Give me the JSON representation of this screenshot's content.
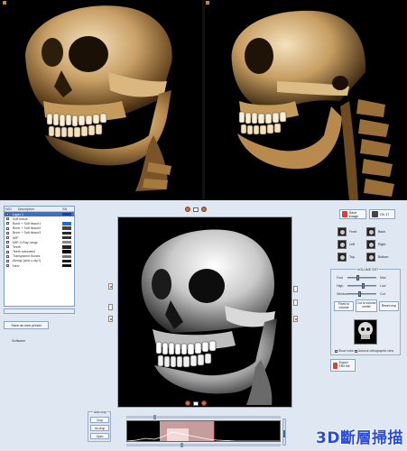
{
  "layers": {
    "headers": [
      "IVID",
      "Description",
      "SN"
    ],
    "rows": [
      {
        "label": "Layer 1",
        "selected": true,
        "color": "#1a3faa"
      },
      {
        "label": "Soft tissue",
        "selected": false,
        "color": "#ffffff"
      },
      {
        "label": "Bone + Soft tissue1",
        "selected": false,
        "color": "#1a6fd0"
      },
      {
        "label": "Bone + Soft tissue2",
        "selected": false,
        "color": "#444444"
      },
      {
        "label": "Bone + Soft tissue3",
        "selected": false,
        "color": "#2a2a2a"
      },
      {
        "label": "MIP",
        "selected": false,
        "color": "#333333"
      },
      {
        "label": "MIP-X-Ray range",
        "selected": false,
        "color": "#888888"
      },
      {
        "label": "Teeth",
        "selected": false,
        "color": "#222222"
      },
      {
        "label": "Teeth saturated",
        "selected": false,
        "color": "#000000"
      },
      {
        "label": "Transparent Bones",
        "selected": false,
        "color": "#777777"
      },
      {
        "label": "Airway (and x-ray?)",
        "selected": false,
        "color": "#1d1d1d"
      },
      {
        "label": "Nerv",
        "selected": false,
        "color": "#0f0f0f"
      }
    ]
  },
  "left_controls": {
    "button1": "",
    "button2": "Save as new preset",
    "label": "Software"
  },
  "top_tools": {
    "snapshot": "Save image",
    "export": "Oh 17"
  },
  "views": [
    {
      "label": "Front"
    },
    {
      "label": "Back"
    },
    {
      "label": "Left"
    },
    {
      "label": "Right"
    },
    {
      "label": "Top"
    },
    {
      "label": "Bottom"
    }
  ],
  "volume": {
    "title": "VOLUME SET",
    "sliders": [
      {
        "label": "Fwd",
        "right": "Max",
        "value": 0.35
      },
      {
        "label": "High",
        "right": "Low",
        "value": 0.55
      },
      {
        "label": "Window",
        "right": "Cut",
        "value": 0.4
      }
    ],
    "buttons": {
      "show_volume": "Fixed to volume",
      "cut_volume": "Cut to volume center",
      "reset_crop": "Reset crop"
    },
    "checks": [
      "Show cube",
      "Autocut orthographic view"
    ]
  },
  "export_button": "Export FBX file",
  "bottom_group": {
    "title": "Auto crop",
    "buttons": [
      "Crop",
      "Un-crop",
      "Open"
    ]
  },
  "watermark": "3D斷層掃描"
}
